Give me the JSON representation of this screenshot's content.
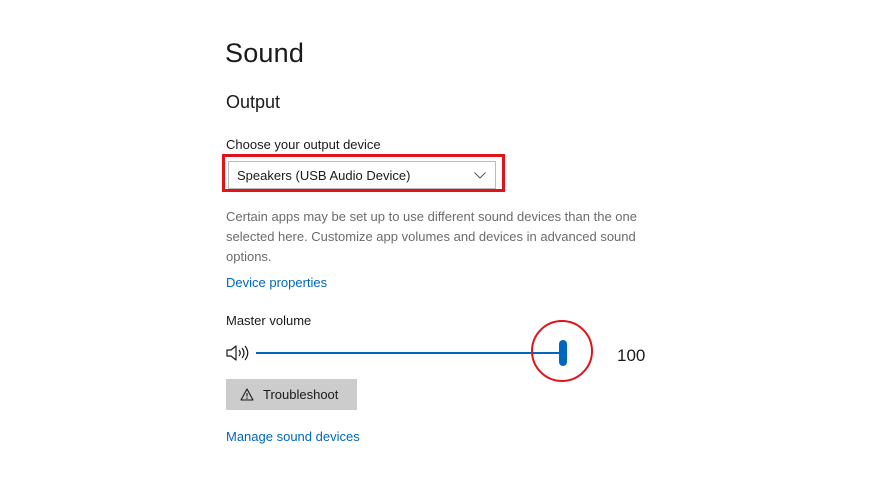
{
  "page": {
    "title": "Sound"
  },
  "output": {
    "section_title": "Output",
    "device_label": "Choose your output device",
    "device_select": {
      "selected_value": "Speakers (USB Audio Device)",
      "icon": "chevron-down-icon"
    },
    "info_text": "Certain apps may be set up to use different sound devices than the one selected here. Customize app volumes and devices in advanced sound options.",
    "device_properties_link": "Device properties",
    "master_volume": {
      "label": "Master volume",
      "value_text": "100",
      "level": 1.0,
      "icon": "speaker-icon"
    },
    "troubleshoot_button": {
      "label": "Troubleshoot",
      "icon": "warning-icon"
    },
    "manage_devices_link": "Manage sound devices"
  },
  "colors": {
    "accent": "#0067c0",
    "annotation": "#e0131a",
    "button_bg": "#cccccc",
    "secondary_text": "#6b6b6b"
  }
}
